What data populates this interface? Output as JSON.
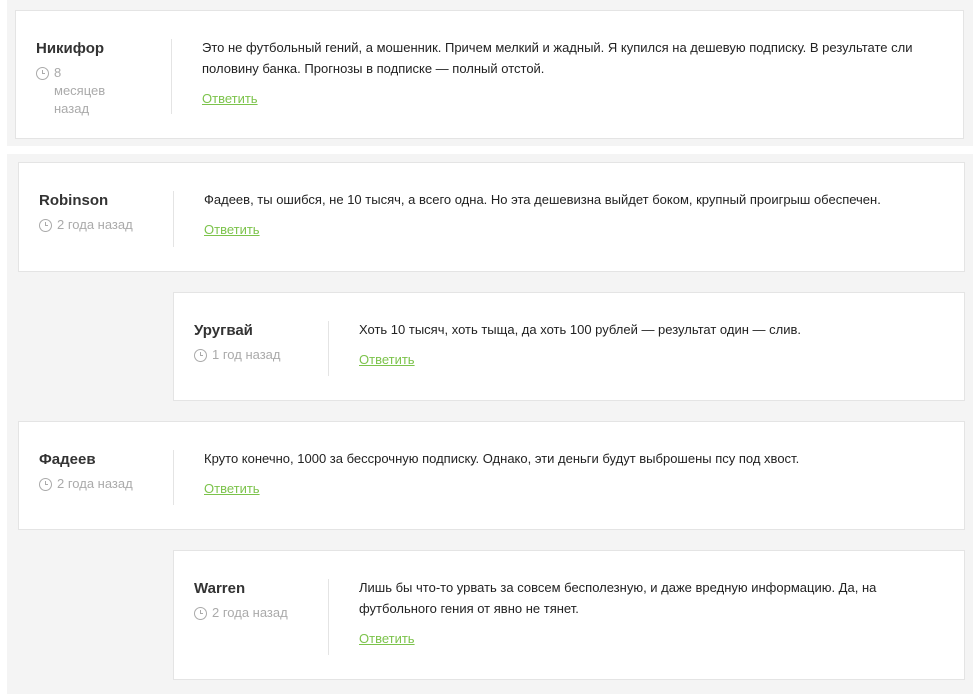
{
  "comments": [
    {
      "author": "Никифор",
      "time": "8 месяцев назад",
      "text": "Это не футбольный гений, а мошенник. Причем мелкий и жадный. Я купился на дешевую подписку. В результате сли половину банка. Прогнозы в подписке — полный отстой.",
      "reply_label": "Ответить"
    },
    {
      "author": "Robinson",
      "time": "2 года назад",
      "text": "Фадеев, ты ошибся, не 10 тысяч, а всего одна. Но эта дешевизна выйдет боком, крупный проигрыш обеспечен.",
      "reply_label": "Ответить"
    },
    {
      "author": "Уругвай",
      "time": "1 год назад",
      "text": "Хоть 10 тысяч, хоть тыща, да хоть 100 рублей — результат один — слив.",
      "reply_label": "Ответить"
    },
    {
      "author": "Фадеев",
      "time": "2 года назад",
      "text": "Круто конечно, 1000 за бессрочную подписку. Однако, эти деньги будут выброшены псу под хвост.",
      "reply_label": "Ответить"
    },
    {
      "author": "Warren",
      "time": "2 года назад",
      "text": "Лишь бы что-то урвать за совсем бесполезную, и даже вредную информацию. Да, на футбольного гения от явно не тянет.",
      "reply_label": "Ответить"
    }
  ],
  "colors": {
    "reply_link": "#7cc34b",
    "meta_text": "#aaaaaa",
    "background": "#f4f4f4"
  }
}
